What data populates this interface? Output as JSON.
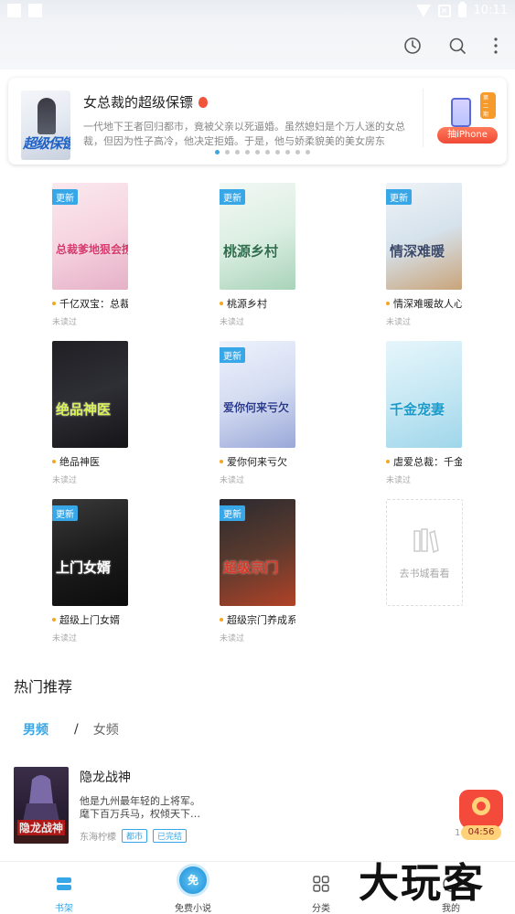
{
  "status_bar": {
    "time": "10:11"
  },
  "banner": {
    "cover_title": "超级保镖",
    "title": "女总裁的超级保镖",
    "description": "一代地下王者回归都市，竟被父亲以死逼婚。虽然媳妇是个万人迷的女总裁，但因为性子高冷，他决定拒婚。于是，他与娇柔貌美的美女房东往……",
    "ad_badge": "第二期",
    "ad_button": "抽iPhone",
    "page_count": 10,
    "active_page": 0
  },
  "bookshelf": {
    "books": [
      {
        "title": "千亿双宝：总裁爹地狠会撩",
        "status": "未读过",
        "badge": "更新",
        "cover_text": "总裁爹地狠会撩",
        "cover_colors": [
          "#fbe9ee",
          "#f6d4e0",
          "#e5b0c6"
        ],
        "cover_text_color": "#d63a6d"
      },
      {
        "title": "桃源乡村",
        "status": "未读过",
        "badge": "更新",
        "cover_text": "桃源乡村",
        "cover_colors": [
          "#f3f8f4",
          "#dcefe3",
          "#a9d3b9"
        ],
        "cover_text_color": "#2f6e4d"
      },
      {
        "title": "情深难暖故人心",
        "status": "未读过",
        "badge": "更新",
        "cover_text": "情深难暖",
        "cover_colors": [
          "#eef3f7",
          "#d6e2ec",
          "#c9a47a"
        ],
        "cover_text_color": "#3c4a6a"
      },
      {
        "title": "绝品神医",
        "status": "未读过",
        "badge": "",
        "cover_text": "绝品神医",
        "cover_colors": [
          "#1f1f24",
          "#2e2e35",
          "#151518"
        ],
        "cover_text_color": "#d9f25b"
      },
      {
        "title": "爱你何来亏欠",
        "status": "未读过",
        "badge": "更新",
        "cover_text": "爱你何来亏欠",
        "cover_colors": [
          "#eef2fb",
          "#d4dcf2",
          "#9aa8d8"
        ],
        "cover_text_color": "#2a3a8f"
      },
      {
        "title": "虐爱总裁：千金宠妻",
        "status": "未读过",
        "badge": "",
        "cover_text": "千金宠妻",
        "cover_colors": [
          "#e7f6fb",
          "#c6e8f4",
          "#9fd6ea"
        ],
        "cover_text_color": "#1a9acb"
      },
      {
        "title": "超级上门女婿",
        "status": "未读过",
        "badge": "更新",
        "cover_text": "上门女婿",
        "cover_colors": [
          "#3a3a3a",
          "#1c1c1c",
          "#0c0c0c"
        ],
        "cover_text_color": "#ffffff"
      },
      {
        "title": "超级宗门养成系统",
        "status": "未读过",
        "badge": "更新",
        "cover_text": "超级宗门",
        "cover_colors": [
          "#2a2a30",
          "#5a3a2e",
          "#b14228"
        ],
        "cover_text_color": "#d63a2a"
      }
    ],
    "add_label": "去书城看看"
  },
  "recommend": {
    "section_title": "热门推荐",
    "tab_male": "男频",
    "tab_separator": "/",
    "tab_female": "女频",
    "book": {
      "title": "隐龙战神",
      "description": "他是九州最年轻的上将军。麾下百万兵马，权倾天下…",
      "author": "东海柠檬",
      "tags": [
        "都市",
        "已完结"
      ],
      "cover_text": "隐龙战神"
    }
  },
  "floating": {
    "countdown": "04:56",
    "side_num": "1"
  },
  "bottom_nav": {
    "items": [
      {
        "label": "书架",
        "icon": "bookshelf-icon"
      },
      {
        "label": "免费小说",
        "icon": "free-novel-icon",
        "icon_text": "免"
      },
      {
        "label": "分类",
        "icon": "category-grid-icon"
      },
      {
        "label": "我的",
        "icon": "profile-icon"
      }
    ]
  },
  "watermark": "大玩客",
  "colors": {
    "accent": "#37a7e8",
    "dot_active": "#3ba6e0",
    "tag_orange": "#f5a623",
    "ad_red": "#f04934"
  }
}
